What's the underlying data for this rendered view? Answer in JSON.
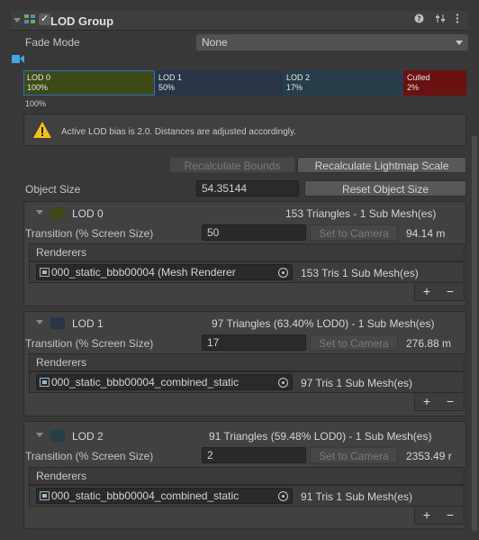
{
  "header": {
    "title": "LOD Group",
    "checkbox_mark": "✓",
    "help_icon": "help-icon",
    "preset_icon": "preset-icon",
    "menu_icon": "kebab-menu-icon"
  },
  "fade_mode": {
    "label": "Fade Mode",
    "value": "None"
  },
  "lod_bar": [
    {
      "name": "LOD 0",
      "percent": "100%",
      "color": "#3d4a16"
    },
    {
      "name": "LOD 1",
      "percent": "50%",
      "color": "#283547"
    },
    {
      "name": "LOD 2",
      "percent": "17%",
      "color": "#263e4a"
    },
    {
      "name": "Culled",
      "percent": "2%",
      "color": "#6a1212"
    }
  ],
  "lod_bar_start": "100%",
  "helpbox": {
    "text": "Active LOD bias is 2.0. Distances are adjusted accordingly.",
    "icon": "warning-icon"
  },
  "buttons": {
    "recalc_bounds": "Recalculate Bounds",
    "recalc_lightmap": "Recalculate Lightmap Scale",
    "reset_object_size": "Reset Object Size"
  },
  "object_size": {
    "label": "Object Size",
    "value": "54.35144"
  },
  "lods": [
    {
      "name": "LOD 0",
      "summary": "153 Triangles  - 1 Sub Mesh(es)",
      "transition_label": "Transition (% Screen Size)",
      "transition_value": "50",
      "set_to_camera": "Set to Camera",
      "distance": "94.14 m",
      "renderers_label": "Renderers",
      "renderer_name": "000_static_bbb00004 (Mesh Renderer",
      "renderer_info": "153 Tris 1 Sub Mesh(es)",
      "swatch": "#3d4a16"
    },
    {
      "name": "LOD 1",
      "summary": "97 Triangles (63.40% LOD0) - 1 Sub Mesh(es)",
      "transition_label": "Transition (% Screen Size)",
      "transition_value": "17",
      "set_to_camera": "Set to Camera",
      "distance": "276.88 m",
      "renderers_label": "Renderers",
      "renderer_name": "000_static_bbb00004_combined_static",
      "renderer_info": "97 Tris 1 Sub Mesh(es)",
      "swatch": "#283547"
    },
    {
      "name": "LOD 2",
      "summary": "91 Triangles (59.48% LOD0) - 1 Sub Mesh(es)",
      "transition_label": "Transition (% Screen Size)",
      "transition_value": "2",
      "set_to_camera": "Set to Camera",
      "distance": "2353.49 r",
      "renderers_label": "Renderers",
      "renderer_name": "000_static_bbb00004_combined_static",
      "renderer_info": "91 Tris 1 Sub Mesh(es)",
      "swatch": "#263e4a"
    }
  ],
  "plus": "+",
  "minus": "−"
}
